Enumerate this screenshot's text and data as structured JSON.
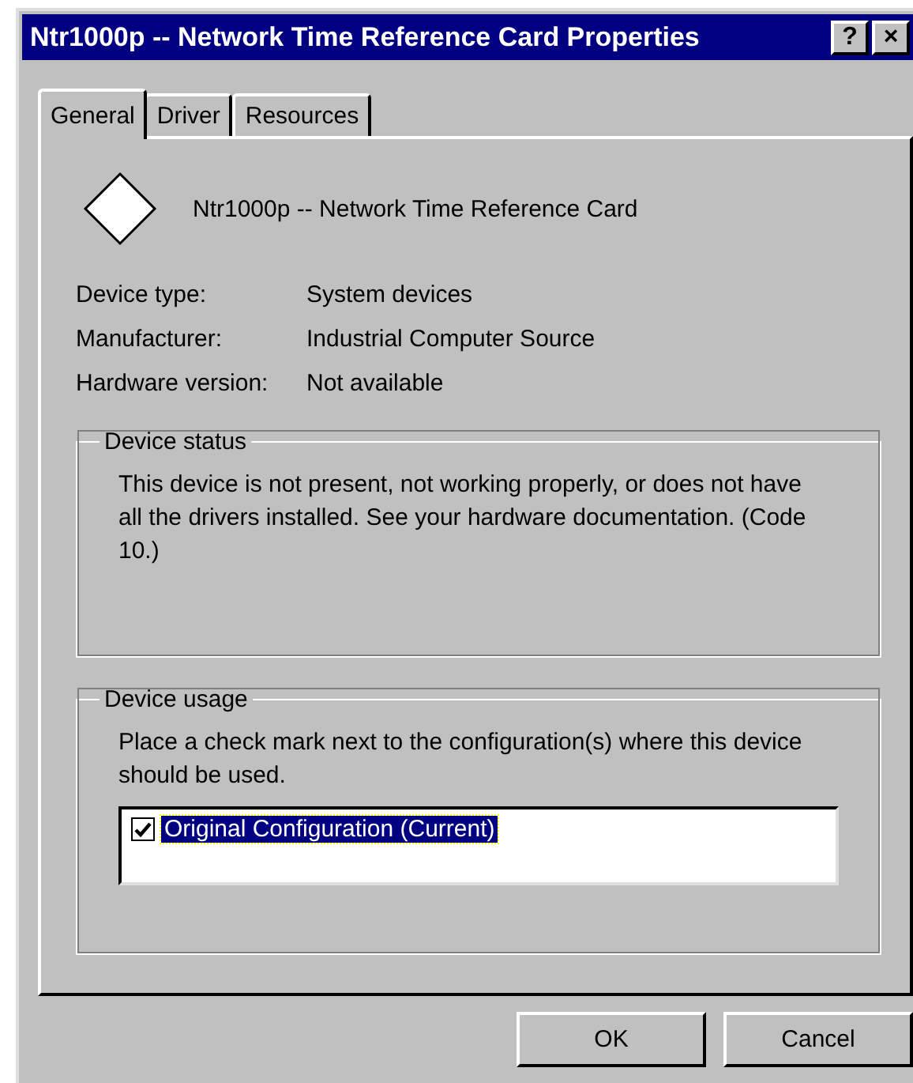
{
  "window": {
    "title": "Ntr1000p -- Network Time Reference Card Properties",
    "title_buttons": [
      "?",
      "×"
    ]
  },
  "tabs": [
    {
      "label": "General",
      "selected": true
    },
    {
      "label": "Driver",
      "selected": false
    },
    {
      "label": "Resources",
      "selected": false
    }
  ],
  "device_name": "Ntr1000p -- Network Time Reference Card",
  "properties": [
    {
      "label": "Device type:",
      "value": "System devices"
    },
    {
      "label": "Manufacturer:",
      "value": "Industrial Computer Source"
    },
    {
      "label": "Hardware version:",
      "value": "Not available"
    }
  ],
  "device_status": {
    "title": "Device status",
    "text": "This device is not present, not working properly, or does not have all the drivers installed. See your hardware documentation.  (Code 10.)"
  },
  "device_usage": {
    "title": "Device usage",
    "text": "Place a check mark next to the configuration(s) where this device should be used.",
    "configurations": [
      {
        "label": "Original Configuration  (Current)",
        "checked": true,
        "selected": true
      }
    ]
  },
  "buttons": [
    "OK",
    "Cancel"
  ]
}
